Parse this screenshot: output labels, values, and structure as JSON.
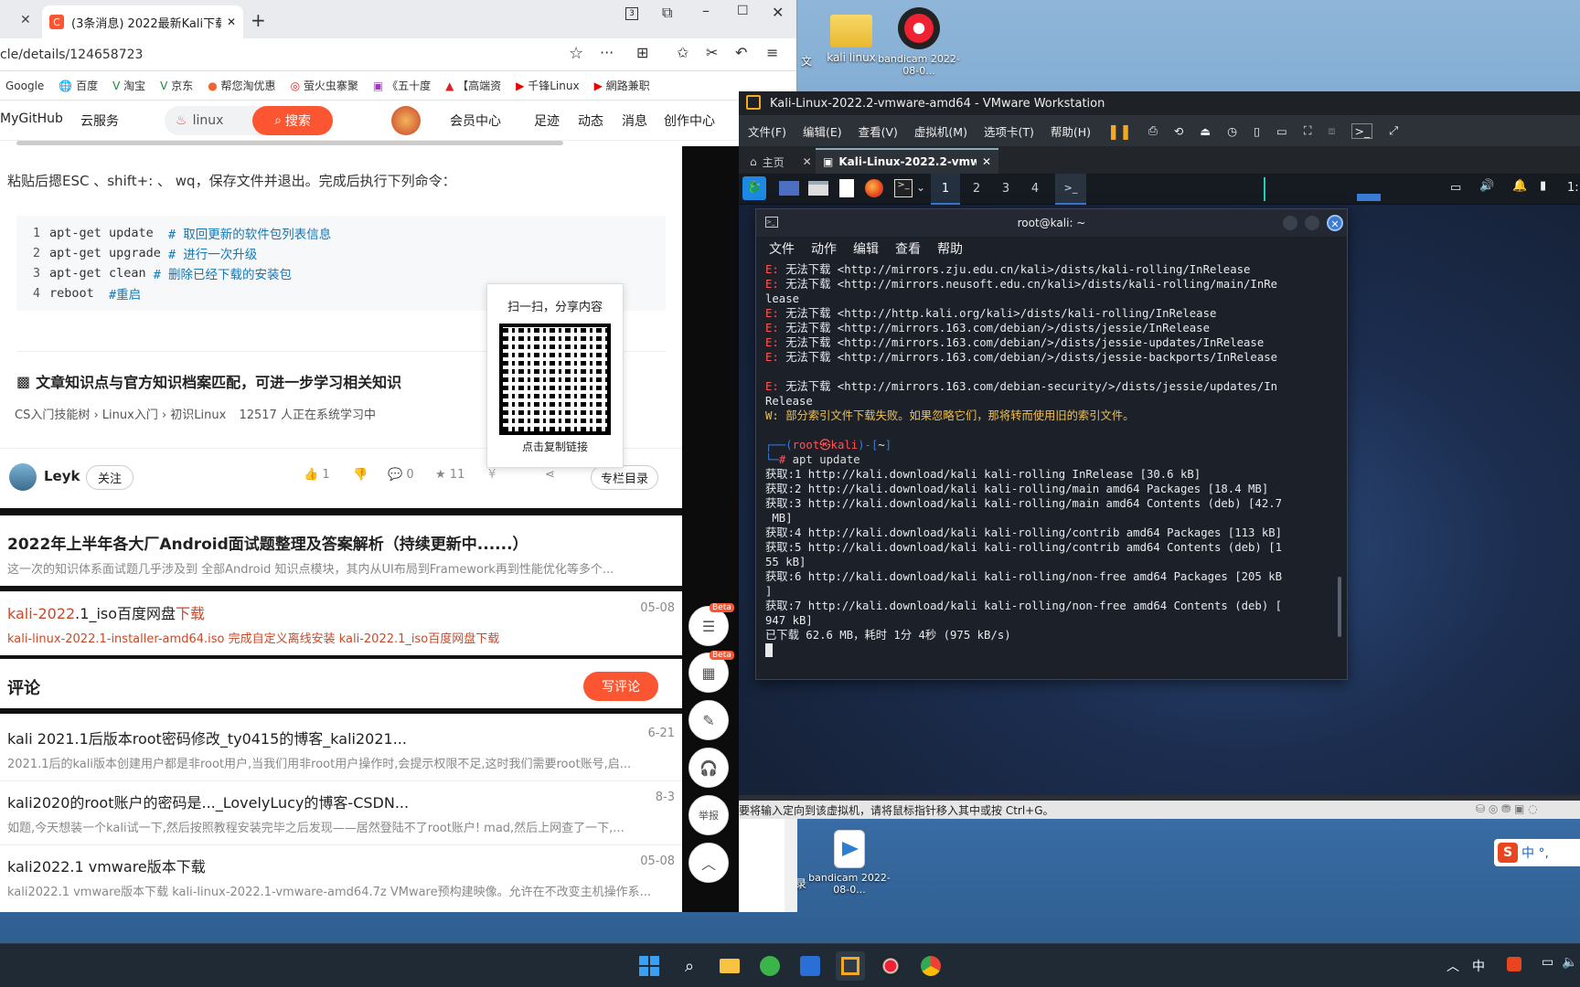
{
  "desktop": {
    "icons": [
      {
        "label": "kali linux"
      },
      {
        "label": "bandicam 2022-08-0..."
      },
      {
        "label": "bandicam 2022-08-0..."
      }
    ],
    "partial_left_label": "文",
    "partial_left_label2": "录"
  },
  "browser": {
    "tab_title": "(3条消息) 2022最新Kali下载",
    "tab_count_badge": "3",
    "url": "cle/details/124658723",
    "bookmarks": [
      "Google",
      "百度",
      "淘宝",
      "京东",
      "帮您淘优惠",
      "萤火虫寨聚",
      "《五十度",
      "【高端资",
      "千锋Linux",
      "網路兼职"
    ],
    "site_nav": {
      "left1": "MyGitHub",
      "left2": "云服务",
      "search_value": "linux",
      "search_button": "搜索",
      "links": [
        "会员中心",
        "足迹",
        "动态",
        "消息",
        "创作中心"
      ]
    },
    "article": {
      "instruction": "粘贴后摁ESC 、shift+: 、 wq，保存文件并退出。完成后执行下列命令：",
      "code": [
        {
          "n": "1",
          "cmd": "apt-get update  ",
          "comment": "# 取回更新的软件包列表信息"
        },
        {
          "n": "2",
          "cmd": "apt-get upgrade ",
          "comment": "# 进行一次升级"
        },
        {
          "n": "3",
          "cmd": "apt-get clean ",
          "comment": "# 删除已经下载的安装包"
        },
        {
          "n": "4",
          "cmd": "reboot  ",
          "comment": "#重启"
        }
      ],
      "knowledge_title": "文章知识点与官方知识档案匹配，可进一步学习相关知识",
      "knowledge_path": "CS入门技能树 › Linux入门 › 初识Linux",
      "knowledge_count": "12517 人正在系统学习中",
      "qr_title": "扫一扫，分享内容",
      "qr_caption": "点击复制链接",
      "author": "Leyk",
      "follow": "关注",
      "likes": "1",
      "comments": "0",
      "stars": "11",
      "column_btn": "专栏目录"
    },
    "recommendations": [
      {
        "title_pre": "2022年上半年各大厂Android面试题整理及答案解析（持续更新中......）",
        "date": "",
        "desc": "这一次的知识体系面试题几乎涉及到 全部Android 知识点模块，其内从UI布局到Framework再到性能优化等多个..."
      },
      {
        "title_hl": "kali-2022",
        "title_mid": ".1_iso百度网盘",
        "title_hl2": "下载",
        "date": "05-08",
        "desc": "kali-linux-2022.1-installer-amd64.iso 完成自定义离线安装 kali-2022.1_iso百度网盘下载"
      }
    ],
    "comment_label": "评论",
    "write_comment": "写评论",
    "more": [
      {
        "title": "kali 2021.1后版本root密码修改_ty0415的博客_kali2021...",
        "date": "6-21",
        "desc": "2021.1后的kali版本创建用户都是非root用户,当我们用非root用户操作时,会提示权限不足,这时我们需要root账号,启..."
      },
      {
        "title": "kali2020的root账户的密码是..._LovelyLucy的博客-CSDN...",
        "date": "8-3",
        "desc": "如题,今天想装一个kali试一下,然后按照教程安装完毕之后发现——居然登陆不了root账户! mad,然后上网查了一下,..."
      },
      {
        "title": "kali2022.1 vmware版本下载",
        "date": "05-08",
        "desc": "kali2022.1 vmware版本下载 kali-linux-2022.1-vmware-amd64.7z VMware预构建映像。允许在不改变主机操作系..."
      }
    ],
    "fab_badges": [
      "Beta",
      "Beta"
    ],
    "fab_report": "举报"
  },
  "vmware": {
    "window_title": "Kali-Linux-2022.2-vmware-amd64 - VMware Workstation",
    "menu": [
      "文件(F)",
      "编辑(E)",
      "查看(V)",
      "虚拟机(M)",
      "选项卡(T)",
      "帮助(H)"
    ],
    "tabs": [
      "主页",
      "Kali-Linux-2022.2-vmwar..."
    ],
    "status_text": "要将输入定向到该虚拟机，请将鼠标指针移入其中或按 Ctrl+G。",
    "kali_workspaces": [
      "1",
      "2",
      "3",
      "4"
    ],
    "kali_clock": "1:"
  },
  "terminal": {
    "title": "root@kali: ~",
    "menu": [
      "文件",
      "动作",
      "编辑",
      "查看",
      "帮助"
    ],
    "lines": [
      {
        "t": "err",
        "p": "E:",
        "s": " 无法下载 <http://mirrors.zju.edu.cn/kali>/dists/kali-rolling/InRelease"
      },
      {
        "t": "err",
        "p": "E:",
        "s": " 无法下载 <http://mirrors.neusoft.edu.cn/kali>/dists/kali-rolling/main/InRe"
      },
      {
        "t": "plain",
        "p": "",
        "s": "lease"
      },
      {
        "t": "err",
        "p": "E:",
        "s": " 无法下载 <http://http.kali.org/kali>/dists/kali-rolling/InRelease"
      },
      {
        "t": "err",
        "p": "E:",
        "s": " 无法下载 <http://mirrors.163.com/debian/>/dists/jessie/InRelease"
      },
      {
        "t": "err",
        "p": "E:",
        "s": " 无法下载 <http://mirrors.163.com/debian/>/dists/jessie-updates/InRelease"
      },
      {
        "t": "err",
        "p": "E:",
        "s": " 无法下载 <http://mirrors.163.com/debian/>/dists/jessie-backports/InRelease"
      },
      {
        "t": "plain",
        "p": "",
        "s": " "
      },
      {
        "t": "err",
        "p": "E:",
        "s": " 无法下载 <http://mirrors.163.com/debian-security/>/dists/jessie/updates/In"
      },
      {
        "t": "plain",
        "p": "",
        "s": "Release"
      },
      {
        "t": "warn",
        "p": "W:",
        "s": " 部分索引文件下载失败。如果忽略它们，那将转而使用旧的索引文件。"
      },
      {
        "t": "plain",
        "p": "",
        "s": " "
      }
    ],
    "prompt_user": "root㉿kali",
    "prompt_dir": "~",
    "command": "apt update",
    "output": [
      "获取:1 http://kali.download/kali kali-rolling InRelease [30.6 kB]",
      "获取:2 http://kali.download/kali kali-rolling/main amd64 Packages [18.4 MB]",
      "获取:3 http://kali.download/kali kali-rolling/main amd64 Contents (deb) [42.7",
      " MB]",
      "获取:4 http://kali.download/kali kali-rolling/contrib amd64 Packages [113 kB]",
      "获取:5 http://kali.download/kali kali-rolling/contrib amd64 Contents (deb) [1",
      "55 kB]",
      "获取:6 http://kali.download/kali kali-rolling/non-free amd64 Packages [205 kB",
      "]",
      "获取:7 http://kali.download/kali kali-rolling/non-free amd64 Contents (deb) [",
      "947 kB]",
      "已下载 62.6 MB，耗时 1分 4秒 (975 kB/s)"
    ]
  },
  "tray": {
    "ime": "中",
    "ime_bar": "中 °,"
  }
}
